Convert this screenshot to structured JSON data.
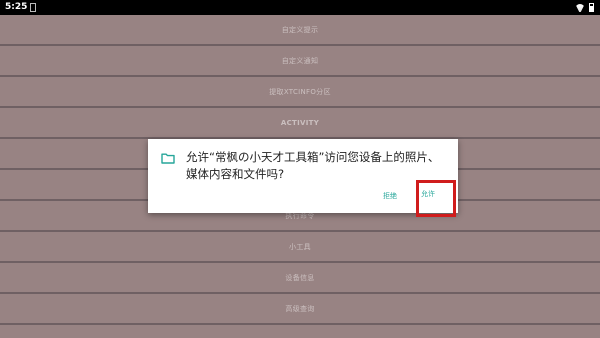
{
  "status_bar": {
    "time": "5:25",
    "icons": [
      "notification-icon",
      "wifi-icon",
      "battery-icon"
    ]
  },
  "menu": {
    "items": [
      {
        "label": "自定义提示"
      },
      {
        "label": "自定义通知"
      },
      {
        "label": "提取XTCINFO分区"
      },
      {
        "label": "ACTIVITY"
      },
      {
        "label": ""
      },
      {
        "label": ""
      },
      {
        "label": "执行命令"
      },
      {
        "label": "小工具"
      },
      {
        "label": "设备信息"
      },
      {
        "label": "高级查询"
      }
    ]
  },
  "dialog": {
    "icon": "folder-icon",
    "message": "允许“常枫の小天才工具箱”访问您设备上的照片、媒体内容和文件吗?",
    "deny_label": "拒绝",
    "allow_label": "允许"
  },
  "highlight": {
    "color": "#d01c1c"
  },
  "colors": {
    "background": "#b39f9f",
    "divider": "#7e7277",
    "accent": "#26a69a"
  }
}
